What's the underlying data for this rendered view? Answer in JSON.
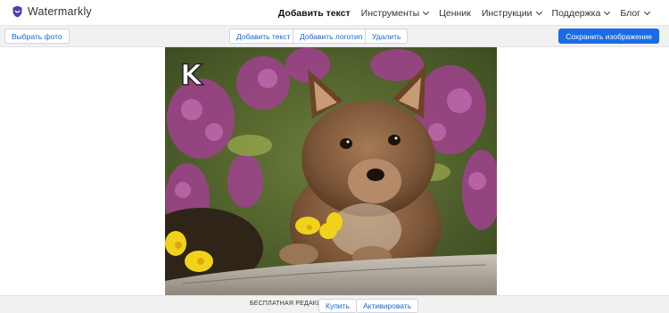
{
  "app": {
    "name": "Watermarkly"
  },
  "nav": {
    "items": [
      {
        "label": "Добавить текст",
        "active": true,
        "dropdown": false
      },
      {
        "label": "Инструменты",
        "active": false,
        "dropdown": true
      },
      {
        "label": "Ценник",
        "active": false,
        "dropdown": false
      },
      {
        "label": "Инструкции",
        "active": false,
        "dropdown": true
      },
      {
        "label": "Поддержка",
        "active": false,
        "dropdown": true
      },
      {
        "label": "Блог",
        "active": false,
        "dropdown": true
      }
    ]
  },
  "toolbar": {
    "select_photo": "Выбрать фото",
    "add_text": "Добавить текст",
    "add_logo": "Добавить логотип",
    "delete": "Удалить",
    "save": "Сохранить изображение"
  },
  "canvas": {
    "watermark_text": "K"
  },
  "footer": {
    "edition": "БЕСПЛАТНАЯ РЕДАКЦИЯ",
    "buy": "Купить",
    "activate": "Активировать"
  },
  "colors": {
    "accent": "#1a6be6",
    "logo": "#4b3fb0"
  }
}
